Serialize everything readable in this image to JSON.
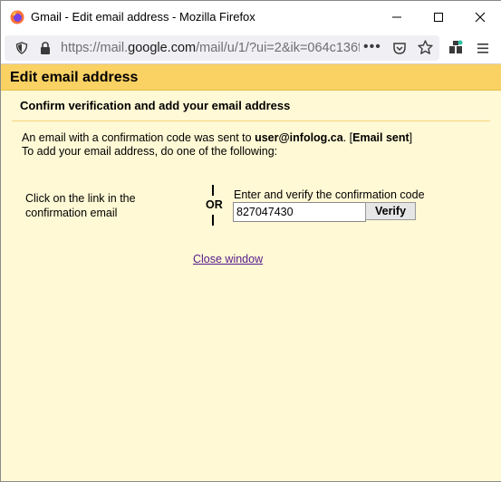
{
  "window": {
    "title": "Gmail - Edit email address - Mozilla Firefox"
  },
  "urlbar": {
    "url_prefix": "https://mail.",
    "url_domain": "google.com",
    "url_suffix": "/mail/u/1/?ui=2&ik=064c136f",
    "more": "•••"
  },
  "dialog": {
    "header": "Edit email address",
    "subheader": "Confirm verification and add your email address",
    "msg_part1": "An email with a confirmation code was sent to ",
    "email": "user@infolog.ca",
    "msg_part2": ". [",
    "email_sent": "Email sent",
    "msg_part3": "]",
    "msg_line2": "To add your email address, do one of the following:",
    "option_left": "Click on the link in the confirmation email",
    "or": "OR",
    "enter_label": "Enter and verify the confirmation code",
    "code_value": "827047430",
    "verify_label": "Verify",
    "close_link": "Close window"
  },
  "colors": {
    "header_bg": "#fad163",
    "content_bg": "#fff9d5",
    "link": "#551a8b"
  }
}
